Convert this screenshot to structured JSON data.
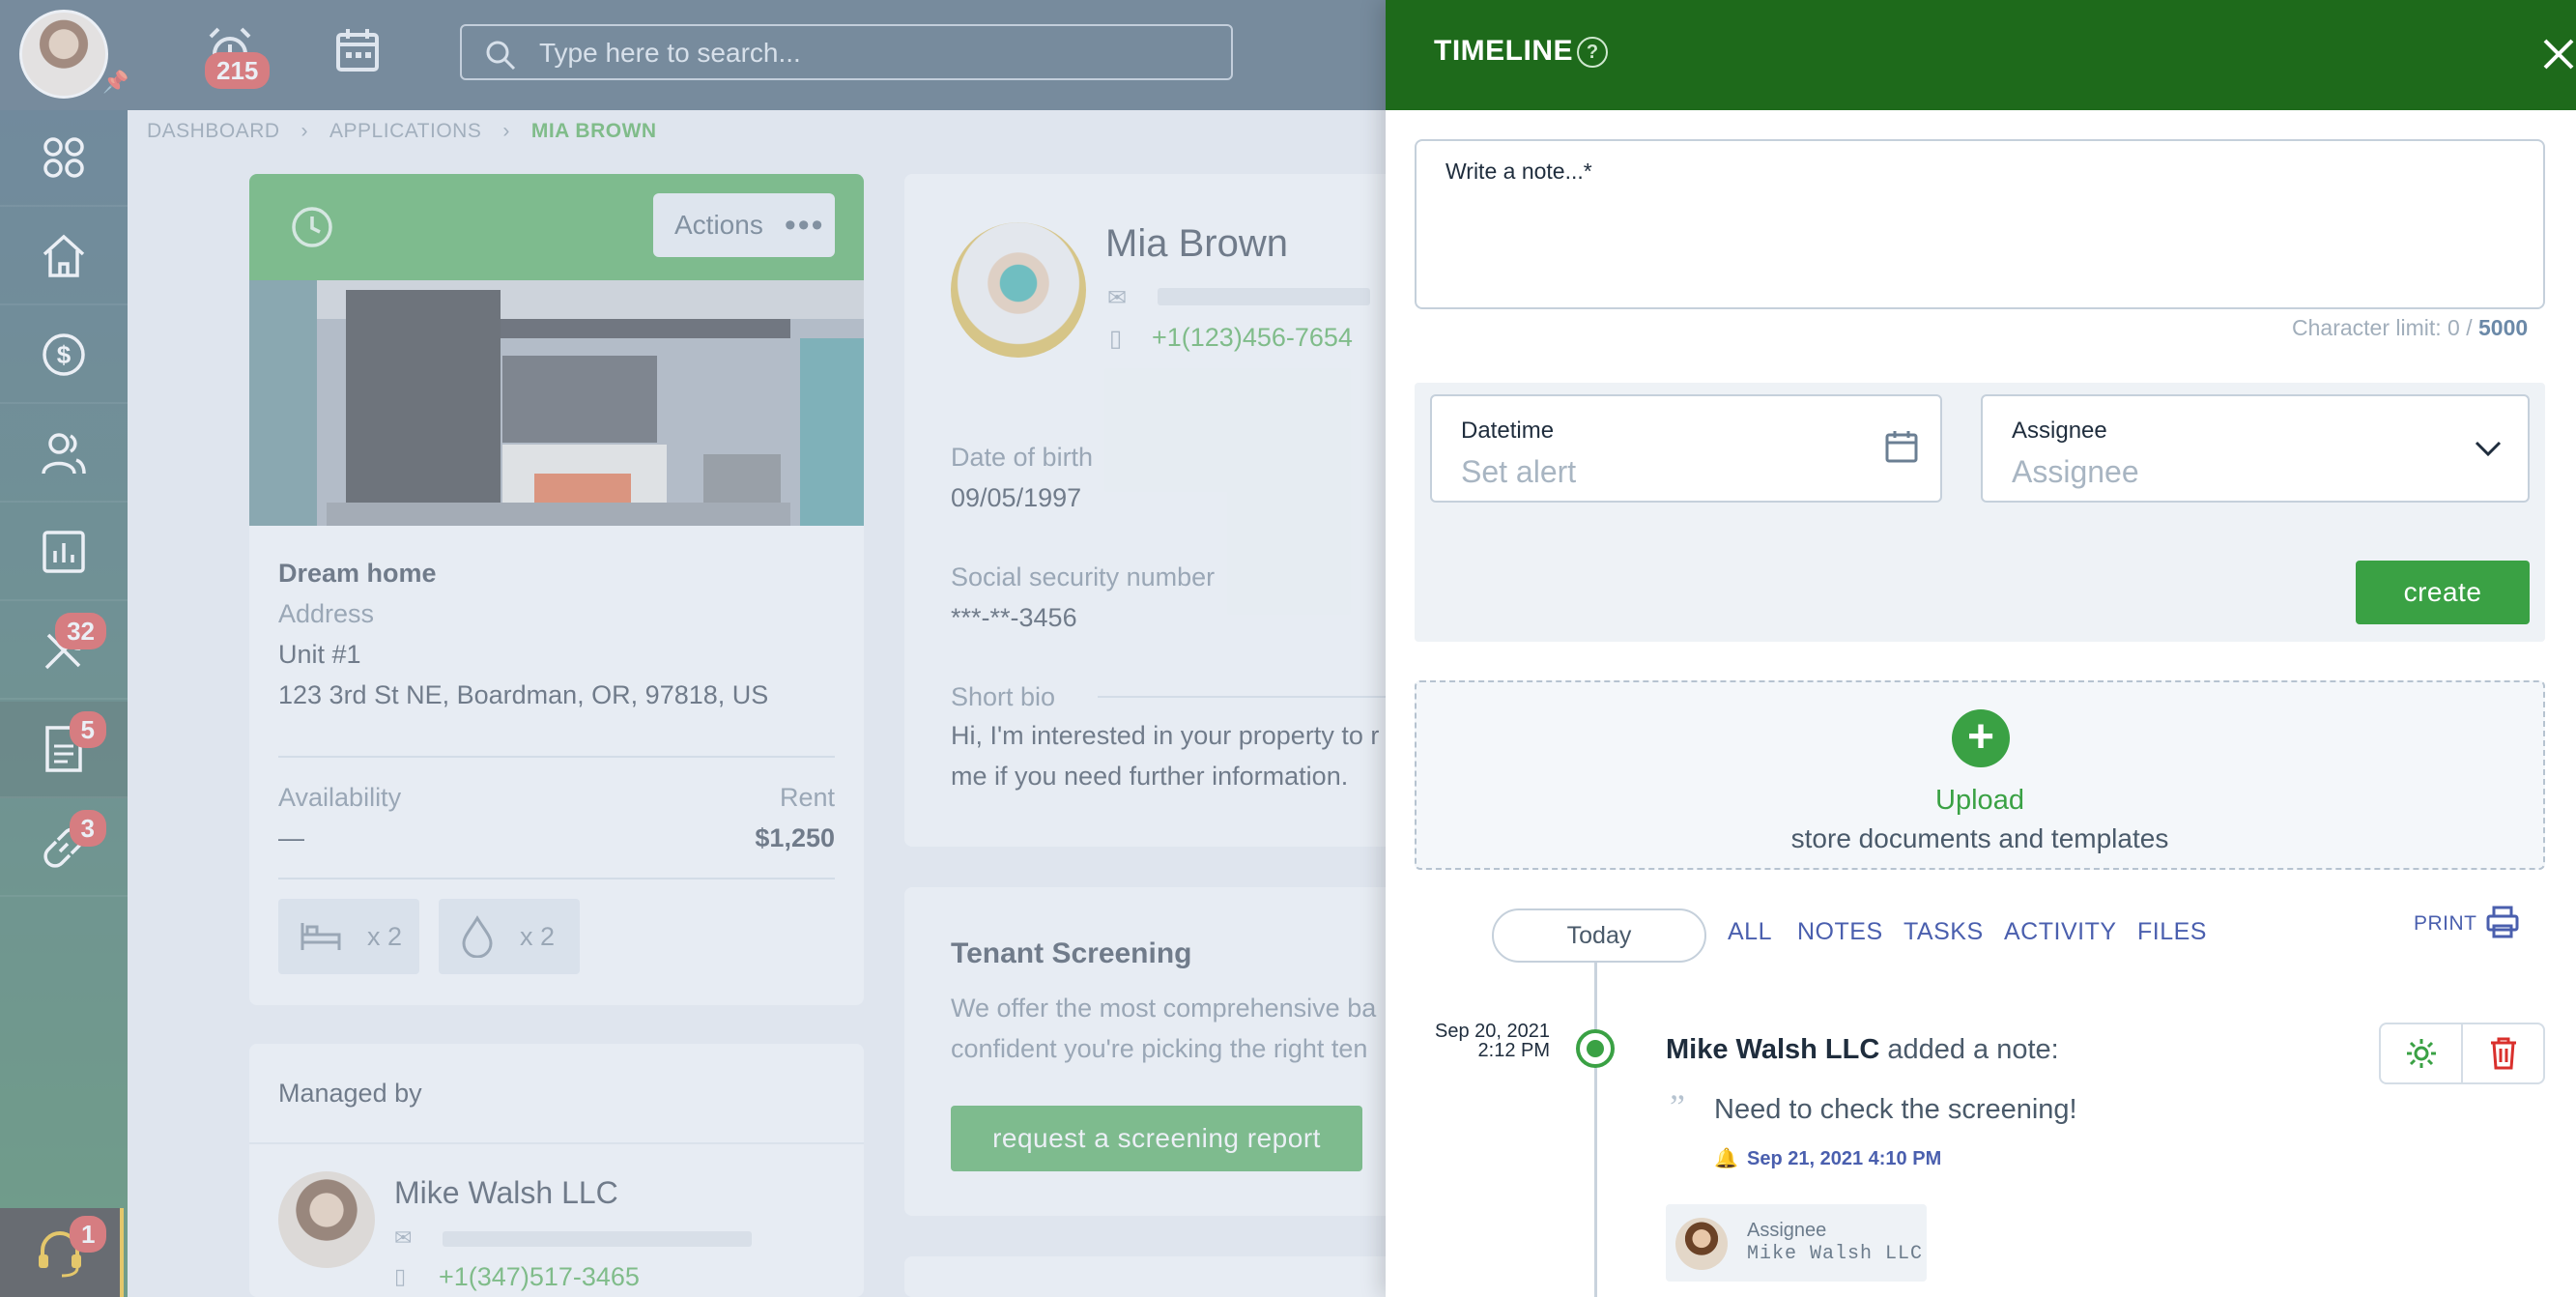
{
  "topbar": {
    "notification_count": "215",
    "search_placeholder": "Type here to search..."
  },
  "sidebar": {
    "items": [
      {
        "icon": "apps-grid-icon",
        "badge": ""
      },
      {
        "icon": "home-icon",
        "badge": ""
      },
      {
        "icon": "dollar-icon",
        "badge": ""
      },
      {
        "icon": "people-icon",
        "badge": ""
      },
      {
        "icon": "report-chart-icon",
        "badge": ""
      },
      {
        "icon": "tools-icon",
        "badge": "32"
      },
      {
        "icon": "document-icon",
        "badge": "5"
      },
      {
        "icon": "link-icon",
        "badge": "3"
      }
    ],
    "support_badge": "1"
  },
  "breadcrumb": [
    "DASHBOARD",
    "APPLICATIONS",
    "MIA BROWN"
  ],
  "property": {
    "actions_label": "Actions",
    "title": "Dream home",
    "address_label": "Address",
    "unit": "Unit #1",
    "address": "123 3rd St NE, Boardman, OR, 97818, US",
    "availability_label": "Availability",
    "availability": "—",
    "rent_label": "Rent",
    "rent": "$1,250",
    "beds": "x 2",
    "baths": "x 2"
  },
  "managed": {
    "label": "Managed by",
    "name": "Mike Walsh LLC",
    "phone": "+1(347)517-3465"
  },
  "applicant": {
    "name": "Mia Brown",
    "phone": "+1(123)456-7654",
    "dob_label": "Date of birth",
    "dob": "09/05/1997",
    "ssn_label": "Social security number",
    "ssn": "***-**-3456",
    "bio_label": "Short bio",
    "bio_line1": "Hi, I'm interested in your property to r",
    "bio_line2": "me if you need further information."
  },
  "screening": {
    "title": "Tenant Screening",
    "text_line1": "We offer the most comprehensive ba",
    "text_line2": "confident you're picking the right ten",
    "button": "request a screening report"
  },
  "timeline": {
    "title": "TIMELINE",
    "note_placeholder": "Write a note...*",
    "char_limit_label": "Character limit: 0 / ",
    "char_limit_max": "5000",
    "datetime_label": "Datetime",
    "datetime_placeholder": "Set alert",
    "assignee_label": "Assignee",
    "assignee_placeholder": "Assignee",
    "create_button": "create",
    "upload_label": "Upload",
    "upload_sub": "store documents and templates",
    "today_label": "Today",
    "tabs": [
      "ALL",
      "NOTES",
      "TASKS",
      "ACTIVITY",
      "FILES"
    ],
    "print_label": "PRINT",
    "entry": {
      "date": "Sep 20, 2021",
      "time": "2:12 PM",
      "author": "Mike Walsh LLC",
      "action": "added a note:",
      "text": "Need to check the screening!",
      "alert": "Sep 21, 2021 4:10 PM",
      "assignee_label": "Assignee",
      "assignee_name": "Mike Walsh LLC"
    }
  }
}
